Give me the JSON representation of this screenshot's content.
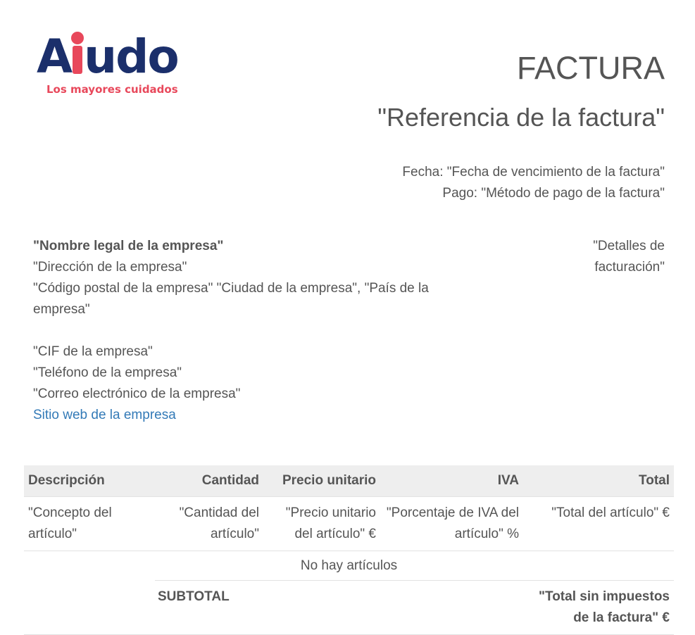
{
  "logo": {
    "word": "Aiudo",
    "word_start": "A",
    "word_end": "udo",
    "tagline": "Los mayores cuidados",
    "colors": {
      "navy": "#1b2f6b",
      "red": "#e8485b"
    }
  },
  "header": {
    "title": "FACTURA",
    "reference": "\"Referencia de la factura\""
  },
  "meta": {
    "date_label": "Fecha:",
    "date_value": "\"Fecha de vencimiento de la factura\"",
    "payment_label": "Pago:",
    "payment_value": "\"Método de pago de la factura\""
  },
  "company": {
    "legal_name": "\"Nombre legal de la empresa\"",
    "address": "\"Dirección de la empresa\"",
    "postal_city_country": "\"Código postal de la empresa\" \"Ciudad de la empresa\", \"País de la empresa\"",
    "tax_id": "\"CIF de la empresa\"",
    "phone": "\"Teléfono de la empresa\"",
    "email": "\"Correo electrónico de la empresa\"",
    "website": "Sitio web de la empresa"
  },
  "billing": {
    "details": "\"Detalles de facturación\""
  },
  "table": {
    "headers": {
      "description": "Descripción",
      "quantity": "Cantidad",
      "unit_price": "Precio unitario",
      "vat": "IVA",
      "total": "Total"
    },
    "row": {
      "description": "\"Concepto del artículo\"",
      "quantity": "\"Cantidad del artículo\"",
      "unit_price": "\"Precio unitario del artículo\" €",
      "vat": "\"Porcentaje de IVA del artículo\" %",
      "total": "\"Total del artículo\" €"
    },
    "empty_message": "No hay artículos",
    "subtotal_label": "SUBTOTAL",
    "subtotal_value": "\"Total sin impuestos de la factura\" €"
  },
  "colors": {
    "text": "#555555",
    "link": "#337ab7",
    "header_bg": "#eeeeee"
  }
}
